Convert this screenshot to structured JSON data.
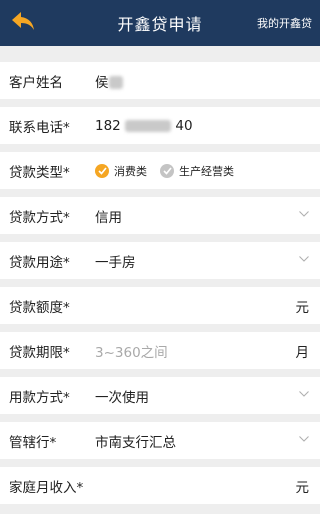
{
  "header": {
    "title": "开鑫贷申请",
    "my_link": "我的开鑫贷",
    "back_icon": "back-arrow-icon",
    "bg_color": "#1f3a5f",
    "accent_color": "#f5a623"
  },
  "form": {
    "customer_name": {
      "label": "客户姓名",
      "value": "侯"
    },
    "phone": {
      "label": "联系电话*",
      "value_prefix": "182",
      "value_suffix": "40"
    },
    "loan_type": {
      "label": "贷款类型*",
      "options": [
        {
          "label": "消费类",
          "selected": true
        },
        {
          "label": "生产经营类",
          "selected": false
        }
      ]
    },
    "loan_method": {
      "label": "贷款方式*",
      "value": "信用"
    },
    "loan_purpose": {
      "label": "贷款用途*",
      "value": "一手房"
    },
    "loan_amount": {
      "label": "贷款额度*",
      "unit": "元"
    },
    "loan_term": {
      "label": "贷款期限*",
      "placeholder": "3~360之间",
      "unit": "月"
    },
    "usage_method": {
      "label": "用款方式*",
      "value": "一次使用"
    },
    "branch": {
      "label": "管辖行*",
      "value": "市南支行汇总"
    },
    "family_income": {
      "label": "家庭月收入*",
      "unit": "元"
    }
  }
}
